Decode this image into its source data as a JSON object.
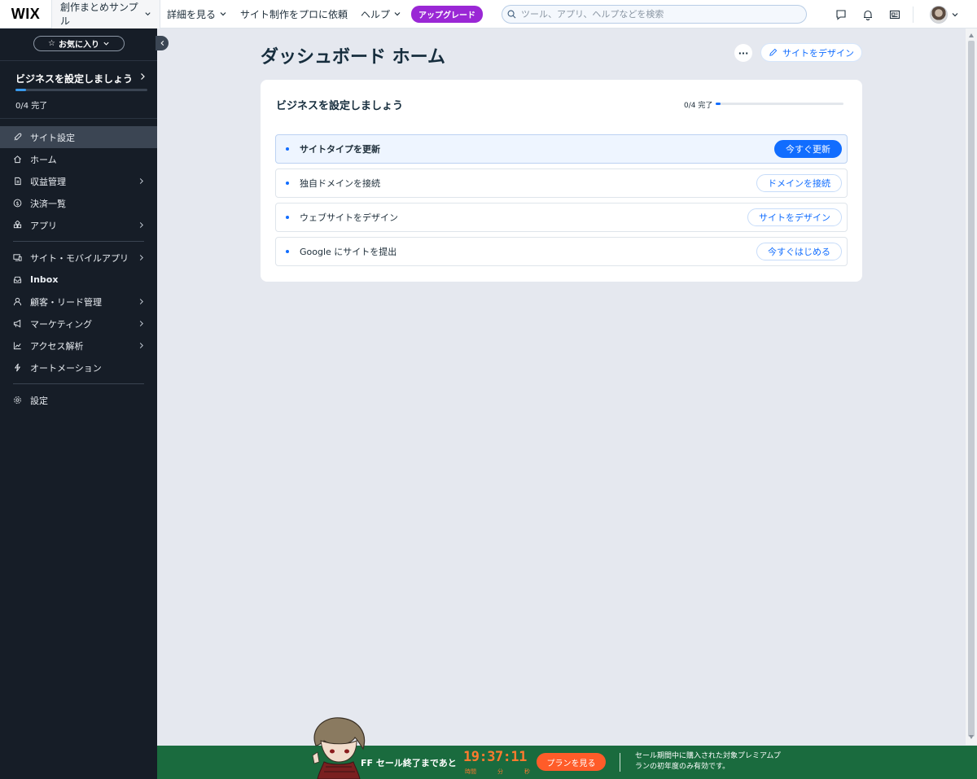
{
  "topbar": {
    "logo": "WIX",
    "site_name": "創作まとめサンプル",
    "nav": [
      {
        "label": "詳細を見る",
        "has_chevron": true
      },
      {
        "label": "サイト制作をプロに依頼",
        "has_chevron": false
      },
      {
        "label": "ヘルプ",
        "has_chevron": true
      }
    ],
    "upgrade_label": "アップグレード",
    "search_placeholder": "ツール、アプリ、ヘルプなどを検索"
  },
  "sidebar": {
    "favorites_label": "お気に入り",
    "setup": {
      "title": "ビジネスを設定しましょう",
      "progress_text": "0/4 完了",
      "progress": 0
    },
    "items": [
      {
        "label": "サイト設定",
        "icon": "rocket-icon",
        "active": true,
        "arrow": false
      },
      {
        "label": "ホーム",
        "icon": "home-icon",
        "active": false,
        "arrow": false
      },
      {
        "label": "収益管理",
        "icon": "revenue-icon",
        "active": false,
        "arrow": true
      },
      {
        "label": "決済一覧",
        "icon": "dollar-icon",
        "active": false,
        "arrow": false
      },
      {
        "label": "アプリ",
        "icon": "apps-icon",
        "active": false,
        "arrow": true
      }
    ],
    "items2": [
      {
        "label": "サイト・モバイルアプリ",
        "icon": "devices-icon",
        "arrow": true
      },
      {
        "label": "Inbox",
        "icon": "inbox-icon",
        "arrow": false
      },
      {
        "label": "顧客・リード管理",
        "icon": "contacts-icon",
        "arrow": true
      },
      {
        "label": "マーケティング",
        "icon": "megaphone-icon",
        "arrow": true
      },
      {
        "label": "アクセス解析",
        "icon": "analytics-icon",
        "arrow": true
      },
      {
        "label": "オートメーション",
        "icon": "automation-icon",
        "arrow": false
      }
    ],
    "items3": [
      {
        "label": "設定",
        "icon": "gear-icon",
        "arrow": false
      }
    ]
  },
  "main": {
    "title": "ダッシュボード ホーム",
    "more_label": "···",
    "design_button": "サイトをデザイン",
    "card": {
      "title": "ビジネスを設定しましょう",
      "progress_text": "0/4 完了",
      "progress": 0,
      "tasks": [
        {
          "label": "サイトタイプを更新",
          "button": "今すぐ更新",
          "current": true
        },
        {
          "label": "独自ドメインを接続",
          "button": "ドメインを接続",
          "current": false
        },
        {
          "label": "ウェブサイトをデザイン",
          "button": "サイトをデザイン",
          "current": false
        },
        {
          "label": "Google にサイトを提出",
          "button": "今すぐはじめる",
          "current": false
        }
      ]
    }
  },
  "banner": {
    "text": "FF セール終了まであと",
    "countdown": "19:37:11",
    "units": [
      "時間",
      "分",
      "秒"
    ],
    "plan_button": "プランを見る",
    "note": "セール期間中に購入された対象プレミアムプランの初年度のみ有効です。"
  },
  "colors": {
    "accent": "#116dff",
    "sidebar_bg": "#161d27",
    "upgrade": "#9a27d5",
    "banner_bg": "#1a6b3e",
    "countdown": "#ff7a2e"
  }
}
